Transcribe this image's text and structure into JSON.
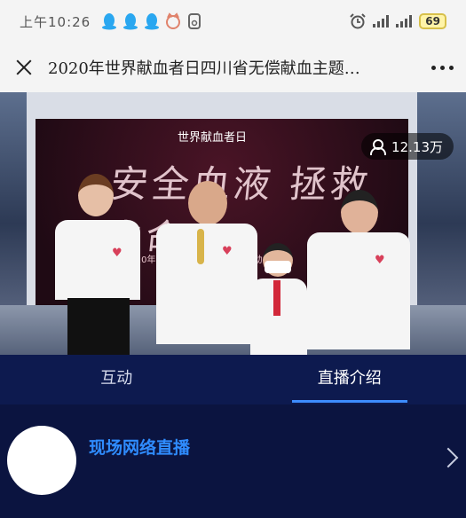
{
  "status_bar": {
    "time": "上午10:26",
    "battery": "69",
    "notification_icons": [
      "qq-icon",
      "qq-icon",
      "qq-icon",
      "cat-icon",
      "phone-icon"
    ],
    "right_icons": [
      "alarm-icon",
      "signal-4g-icon",
      "signal-4g-icon",
      "battery-icon"
    ]
  },
  "nav": {
    "title": "2020年世界献血者日四川省无偿献血主题…",
    "close_icon": "close-icon",
    "more_icon": "more-icon"
  },
  "video": {
    "viewer_count": "12.13万",
    "screen_logo": "世界献血者日",
    "screen_title": "安全血液 拯救生命",
    "screen_sub": "2020年世界…偿献血主题宣传活动"
  },
  "tabs": [
    {
      "label": "互动",
      "active": false
    },
    {
      "label": "直播介绍",
      "active": true
    }
  ],
  "info": {
    "channel_name": "现场网络直播"
  },
  "colors": {
    "accent": "#2f8cff",
    "tab_bg": "#0d1a4f",
    "page_bg": "#0b1440",
    "bar_bg": "#f4f4f4"
  }
}
